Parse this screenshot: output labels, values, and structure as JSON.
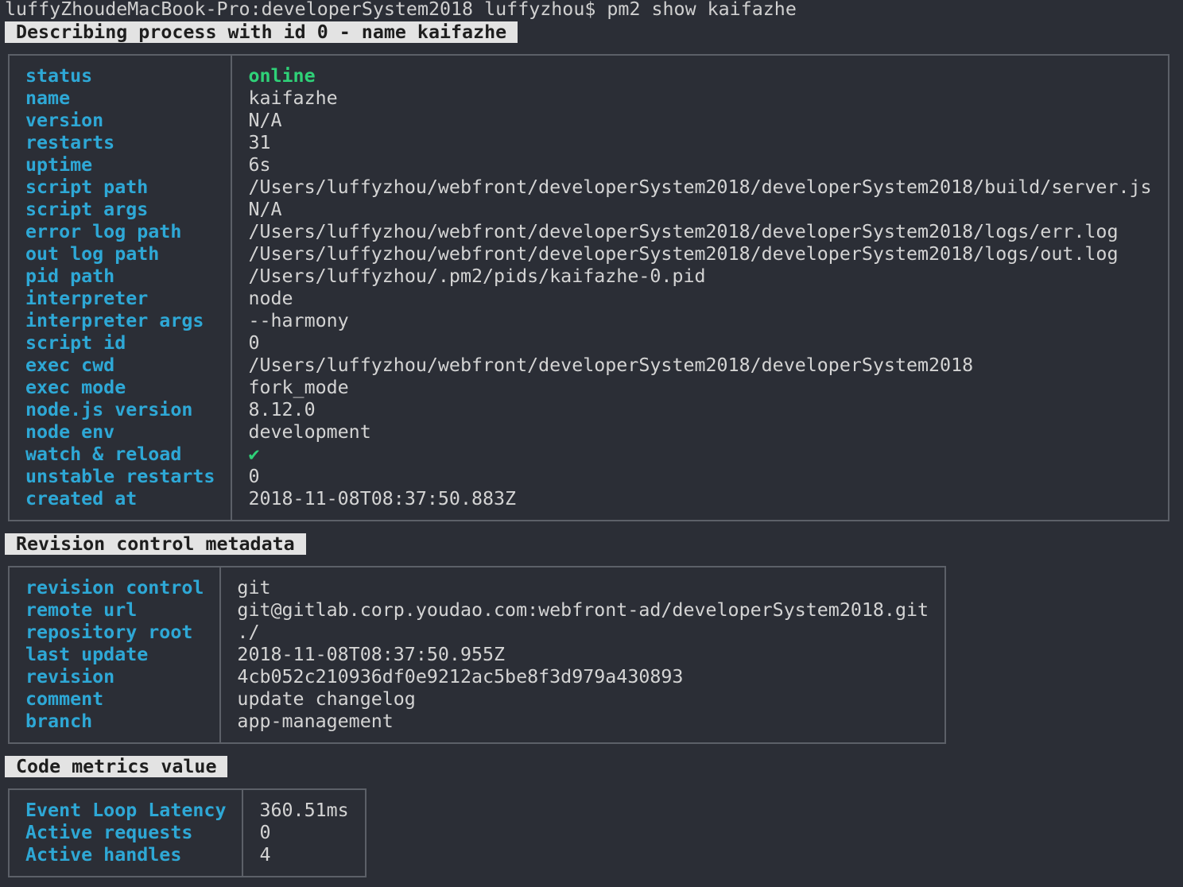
{
  "terminal": {
    "prompt_line": "luffyZhoudeMacBook-Pro:developerSystem2018 luffyzhou$ pm2 show kaifazhe"
  },
  "colors": {
    "background": "#2b2e36",
    "key": "#2ea8d6",
    "value": "#d4d4d4",
    "online": "#2fd178",
    "heading_bg": "#e3e3e3",
    "border": "#5c6068"
  },
  "process": {
    "heading": "Describing process with id 0 - name kaifazhe",
    "rows": [
      {
        "key": "status",
        "value": "online"
      },
      {
        "key": "name",
        "value": "kaifazhe"
      },
      {
        "key": "version",
        "value": "N/A"
      },
      {
        "key": "restarts",
        "value": "31"
      },
      {
        "key": "uptime",
        "value": "6s"
      },
      {
        "key": "script path",
        "value": "/Users/luffyzhou/webfront/developerSystem2018/developerSystem2018/build/server.js"
      },
      {
        "key": "script args",
        "value": "N/A"
      },
      {
        "key": "error log path",
        "value": "/Users/luffyzhou/webfront/developerSystem2018/developerSystem2018/logs/err.log"
      },
      {
        "key": "out log path",
        "value": "/Users/luffyzhou/webfront/developerSystem2018/developerSystem2018/logs/out.log"
      },
      {
        "key": "pid path",
        "value": "/Users/luffyzhou/.pm2/pids/kaifazhe-0.pid"
      },
      {
        "key": "interpreter",
        "value": "node"
      },
      {
        "key": "interpreter args",
        "value": "--harmony"
      },
      {
        "key": "script id",
        "value": "0"
      },
      {
        "key": "exec cwd",
        "value": "/Users/luffyzhou/webfront/developerSystem2018/developerSystem2018"
      },
      {
        "key": "exec mode",
        "value": "fork_mode"
      },
      {
        "key": "node.js version",
        "value": "8.12.0"
      },
      {
        "key": "node env",
        "value": "development"
      },
      {
        "key": "watch & reload",
        "value": "✔"
      },
      {
        "key": "unstable restarts",
        "value": "0"
      },
      {
        "key": "created at",
        "value": "2018-11-08T08:37:50.883Z"
      }
    ]
  },
  "revision": {
    "heading": "Revision control metadata",
    "rows": [
      {
        "key": "revision control",
        "value": "git"
      },
      {
        "key": "remote url",
        "value": "git@gitlab.corp.youdao.com:webfront-ad/developerSystem2018.git"
      },
      {
        "key": "repository root",
        "value": "./"
      },
      {
        "key": "last update",
        "value": "2018-11-08T08:37:50.955Z"
      },
      {
        "key": "revision",
        "value": "4cb052c210936df0e9212ac5be8f3d979a430893"
      },
      {
        "key": "comment",
        "value": "update changelog"
      },
      {
        "key": "branch",
        "value": "app-management"
      }
    ]
  },
  "metrics": {
    "heading": "Code metrics value",
    "rows": [
      {
        "key": "Event Loop Latency",
        "value": "360.51ms"
      },
      {
        "key": "Active requests",
        "value": "0"
      },
      {
        "key": "Active handles",
        "value": "4"
      }
    ]
  }
}
